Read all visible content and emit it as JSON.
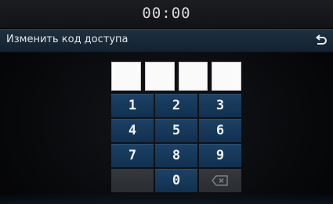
{
  "status_bar": {
    "time": "00:00"
  },
  "header": {
    "title": "Изменить код доступа"
  },
  "code_entry": {
    "box_count": 4
  },
  "keypad": {
    "keys": [
      {
        "label": "1",
        "name": "key-1"
      },
      {
        "label": "2",
        "name": "key-2"
      },
      {
        "label": "3",
        "name": "key-3"
      },
      {
        "label": "4",
        "name": "key-4"
      },
      {
        "label": "5",
        "name": "key-5"
      },
      {
        "label": "6",
        "name": "key-6"
      },
      {
        "label": "7",
        "name": "key-7"
      },
      {
        "label": "8",
        "name": "key-8"
      },
      {
        "label": "9",
        "name": "key-9"
      },
      {
        "label": "",
        "name": "key-blank"
      },
      {
        "label": "0",
        "name": "key-0"
      },
      {
        "label": "",
        "name": "delete-key",
        "icon": "backspace-icon"
      }
    ]
  },
  "colors": {
    "key_blue": "#1c4266",
    "title_bar": "#1e3040",
    "disabled_key": "#35383c"
  }
}
